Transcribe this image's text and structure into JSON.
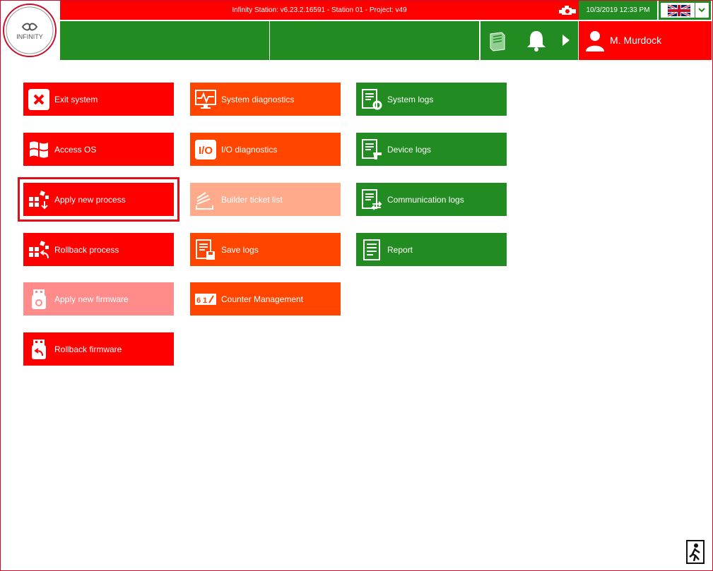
{
  "header": {
    "logo_text": "INFINITY",
    "title": "Infinity Station: v6.23.2.16591 - Station 01 - Project: v49",
    "datetime": "10/3/2019 12:33 PM",
    "language_icon": "uk-flag-icon",
    "user_name": "M. Murdock"
  },
  "tiles": {
    "col1": [
      {
        "label": "Exit system",
        "icon": "close-icon",
        "color": "#ff0000",
        "enabled": true
      },
      {
        "label": "Access OS",
        "icon": "windows-icon",
        "color": "#ff0000",
        "enabled": true
      },
      {
        "label": "Apply new process",
        "icon": "apply-process-icon",
        "color": "#ff0000",
        "enabled": true,
        "selected": true
      },
      {
        "label": "Rollback process",
        "icon": "rollback-process-icon",
        "color": "#ff0000",
        "enabled": true
      },
      {
        "label": "Apply new firmware",
        "icon": "usb-gear-icon",
        "color": "#ff0000",
        "enabled": false
      },
      {
        "label": "Rollback firmware",
        "icon": "usb-back-icon",
        "color": "#ff0000",
        "enabled": true
      }
    ],
    "col2": [
      {
        "label": "System diagnostics",
        "icon": "monitor-pulse-icon",
        "color": "#ff4500",
        "enabled": true
      },
      {
        "label": "I/O diagnostics",
        "icon": "io-icon",
        "color": "#ff4500",
        "enabled": true
      },
      {
        "label": "Builder ticket list",
        "icon": "ticket-stack-icon",
        "color": "#ff4500",
        "enabled": false
      },
      {
        "label": "Save logs",
        "icon": "save-logs-icon",
        "color": "#ff4500",
        "enabled": true
      },
      {
        "label": "Counter Management",
        "icon": "counter-icon",
        "color": "#ff4500",
        "enabled": true
      }
    ],
    "col3": [
      {
        "label": "System logs",
        "icon": "log-gear-icon",
        "color": "#228b22",
        "enabled": true
      },
      {
        "label": "Device logs",
        "icon": "log-device-icon",
        "color": "#228b22",
        "enabled": true
      },
      {
        "label": "Communication logs",
        "icon": "log-comm-icon",
        "color": "#228b22",
        "enabled": true
      },
      {
        "label": "Report",
        "icon": "report-icon",
        "color": "#228b22",
        "enabled": true
      }
    ]
  },
  "colors": {
    "red": "#ff0000",
    "orange": "#ff4500",
    "green": "#228b22",
    "accent": "#c8102e"
  }
}
